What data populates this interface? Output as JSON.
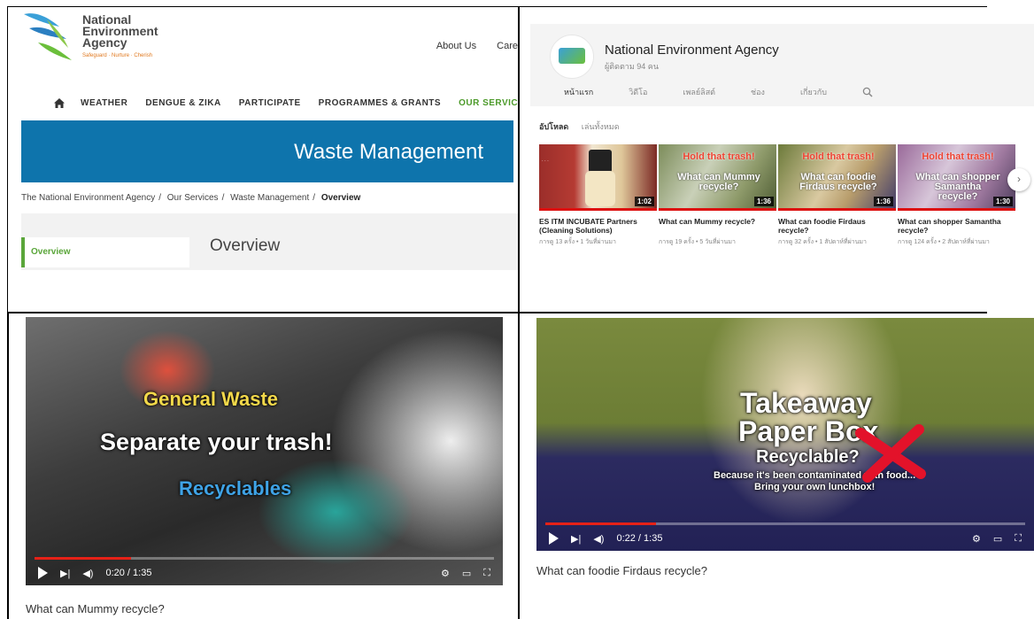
{
  "nea_site": {
    "logo": {
      "line1": "National",
      "line2": "Environment",
      "line3": "Agency",
      "tagline": "Safeguard · Nurture · Cherish"
    },
    "utility_nav": [
      "About Us",
      "Care"
    ],
    "main_nav": [
      "WEATHER",
      "DENGUE & ZIKA",
      "PARTICIPATE",
      "PROGRAMMES & GRANTS",
      "OUR SERVICES"
    ],
    "active_nav": "OUR SERVICES",
    "banner_title": "Waste Management",
    "breadcrumb": [
      "The National Environment Agency",
      "Our Services",
      "Waste Management",
      "Overview"
    ],
    "sidebar_item": "Overview",
    "page_heading": "Overview",
    "colors": {
      "banner": "#0e74ac",
      "accent_green": "#5aa63a"
    }
  },
  "youtube_channel": {
    "channel_name": "National Environment Agency",
    "subscribers": "ผู้ติดตาม 94 คน",
    "tabs": [
      "หน้าแรก",
      "วิดีโอ",
      "เพลย์ลิสต์",
      "ช่อง",
      "เกี่ยวกับ"
    ],
    "active_tab": "หน้าแรก",
    "section_title": "อัปโหลด",
    "play_all": "เล่นทั้งหมด",
    "videos": [
      {
        "title": "ES ITM INCUBATE Partners (Cleaning Solutions)",
        "duration": "1:02",
        "meta": "การดู 13 ครั้ง • 1 วันที่ผ่านมา",
        "overlay_top": "",
        "overlay_bottom": ""
      },
      {
        "title": "What can Mummy recycle?",
        "duration": "1:36",
        "meta": "การดู 19 ครั้ง • 5 วันที่ผ่านมา",
        "overlay_top": "Hold that trash!",
        "overlay_bottom": "What can Mummy recycle?"
      },
      {
        "title": "What can foodie Firdaus recycle?",
        "duration": "1:36",
        "meta": "การดู 32 ครั้ง • 1 สัปดาห์ที่ผ่านมา",
        "overlay_top": "Hold that trash!",
        "overlay_bottom": "What can foodie Firdaus recycle?"
      },
      {
        "title": "What can shopper Samantha recycle?",
        "duration": "1:30",
        "meta": "การดู 124 ครั้ง • 2 สัปดาห์ที่ผ่านมา",
        "overlay_top": "Hold that trash!",
        "overlay_bottom": "What can shopper Samantha recycle?"
      }
    ]
  },
  "video_left": {
    "overlay_1": "General Waste",
    "overlay_2": "Separate your trash!",
    "overlay_3": "Recyclables",
    "time": "0:20 / 1:35",
    "progress": 0.21,
    "caption": "What can Mummy recycle?"
  },
  "video_right": {
    "overlay_1": "Takeaway",
    "overlay_2": "Paper Box",
    "overlay_3": "Recyclable?",
    "overlay_4": "Because it's been contaminated with food...",
    "overlay_5": "Bring your own lunchbox!",
    "time": "0:22 / 1:35",
    "progress": 0.23,
    "caption": "What can foodie Firdaus recycle?"
  }
}
